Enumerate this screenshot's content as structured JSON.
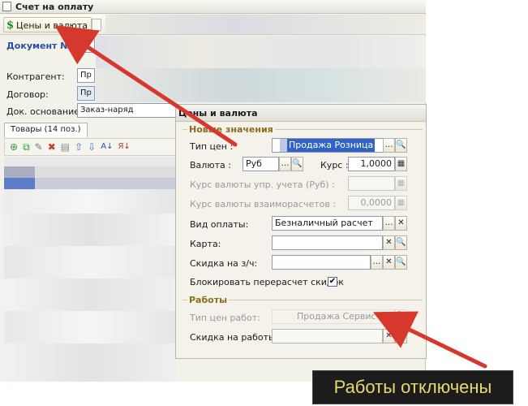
{
  "window": {
    "title": "Счет на оплату"
  },
  "toolbar": {
    "prices_button": "Цены и валюта"
  },
  "document": {
    "label": "Документ №:"
  },
  "fields": {
    "counterparty_label": "Контрагент:",
    "counterparty_value": "Пр",
    "contract_label": "Договор:",
    "contract_value": "Пр",
    "basis_label": "Док. основание:",
    "basis_value": "Заказ-наряд"
  },
  "tab": {
    "label": "Товары (14 поз.)"
  },
  "dialog": {
    "title": "Цены и валюта",
    "new_values_group": "Новые значения",
    "price_type_label": "Тип цен :",
    "price_type_value": "Продажа Розница",
    "currency_label": "Валюта :",
    "currency_value": "Руб",
    "rate_label": "Курс :",
    "rate_value": "1,0000",
    "mgmt_rate_label": "Курс валюты упр. учета (Руб) :",
    "mgmt_rate_value": "",
    "settle_rate_label": "Курс валюты взаиморасчетов :",
    "settle_rate_value": "0,0000",
    "payment_type_label": "Вид оплаты:",
    "payment_type_value": "Безналичный расчет",
    "card_label": "Карта:",
    "card_value": "",
    "parts_discount_label": "Скидка на з/ч:",
    "parts_discount_value": "",
    "block_recalc_label": "Блокировать перерасчет скидок",
    "block_recalc_checked": true,
    "works_group": "Работы",
    "works_price_type_label": "Тип цен работ:",
    "works_price_type_value": "Продажа Сервис",
    "works_discount_label": "Скидка на работы:",
    "works_discount_value": ""
  },
  "annotation": {
    "text": "Работы отключены"
  },
  "colors": {
    "accent_blue": "#3163c6",
    "group_title": "#8b6d1b",
    "arrow_red": "#d7382e",
    "callout_bg": "#1c1c1c",
    "callout_text": "#e7d96d"
  }
}
